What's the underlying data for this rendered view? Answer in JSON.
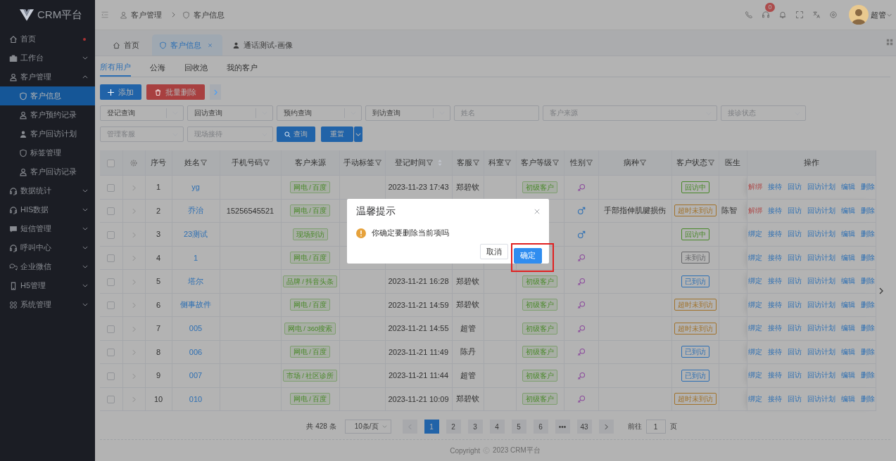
{
  "logo": {
    "text": "CRM平台"
  },
  "sidebar": {
    "items": [
      {
        "label": "首页",
        "selected": false,
        "dot": true
      },
      {
        "label": "工作台",
        "selected": false,
        "expanded": false
      },
      {
        "label": "客户管理",
        "selected": false,
        "expanded": true,
        "children": [
          {
            "label": "客户信息",
            "selected": true
          },
          {
            "label": "客户预约记录",
            "selected": false
          },
          {
            "label": "客户回访计划",
            "selected": false
          },
          {
            "label": "标签管理",
            "selected": false
          },
          {
            "label": "客户回访记录",
            "selected": false
          }
        ]
      },
      {
        "label": "数据统计",
        "selected": false,
        "expanded": false
      },
      {
        "label": "HIS数据",
        "selected": false,
        "expanded": false
      },
      {
        "label": "短信管理",
        "selected": false,
        "expanded": false
      },
      {
        "label": "呼叫中心",
        "selected": false,
        "expanded": false
      },
      {
        "label": "企业微信",
        "selected": false,
        "expanded": false
      },
      {
        "label": "H5管理",
        "selected": false,
        "expanded": false
      },
      {
        "label": "系统管理",
        "selected": false,
        "expanded": false
      }
    ]
  },
  "header": {
    "breadcrumb": [
      "客户管理",
      "客户信息"
    ],
    "notification_count": "0",
    "user": "超管"
  },
  "tabs": [
    {
      "label": "首页",
      "selected": false,
      "closable": false
    },
    {
      "label": "客户信息",
      "selected": true,
      "closable": true
    },
    {
      "label": "通话测试-画像",
      "selected": false,
      "closable": false
    }
  ],
  "subtabs": [
    {
      "label": "所有用户",
      "selected": true
    },
    {
      "label": "公海",
      "selected": false
    },
    {
      "label": "回收池",
      "selected": false
    },
    {
      "label": "我的客户",
      "selected": false
    }
  ],
  "toolbar": [
    {
      "label": "添加",
      "kind": "primary"
    },
    {
      "label": "批量删除",
      "kind": "danger"
    }
  ],
  "filters": [
    [
      {
        "kind": "select",
        "value": "登记查询"
      },
      {
        "kind": "select",
        "value": "回访查询"
      },
      {
        "kind": "select",
        "value": "预约查询"
      },
      {
        "kind": "select",
        "value": "到访查询"
      },
      {
        "kind": "input",
        "placeholder": "姓名"
      },
      {
        "kind": "select",
        "placeholder": "客户来源"
      },
      {
        "kind": "select",
        "placeholder": "接诊状态"
      }
    ],
    [
      {
        "kind": "select",
        "placeholder": "管理客服"
      },
      {
        "kind": "select",
        "placeholder": "现场接待"
      },
      {
        "kind": "primary",
        "label": "查询"
      },
      {
        "kind": "primary",
        "label": "重置"
      }
    ]
  ],
  "table": {
    "select_all": {
      "checked": false
    },
    "columns": [
      {
        "label": "序号",
        "filter": false
      },
      {
        "label": "姓名",
        "filter": true
      },
      {
        "label": "手机号码",
        "filter": true
      },
      {
        "label": "客户来源",
        "filter": false
      },
      {
        "label": "手动标签",
        "filter": true
      },
      {
        "label": "登记时间",
        "filter": true,
        "sortable": true
      },
      {
        "label": "客服",
        "filter": true
      },
      {
        "label": "科室",
        "filter": true
      },
      {
        "label": "客户等级",
        "filter": true
      },
      {
        "label": "性别",
        "filter": true
      },
      {
        "label": "病种",
        "filter": true
      },
      {
        "label": "客户状态",
        "filter": true
      },
      {
        "label": "医生",
        "filter": false
      },
      {
        "label": "操作",
        "filter": false
      }
    ],
    "rows": [
      {
        "checked": false,
        "expanded": false,
        "no": "1",
        "name": "yg",
        "source": "网电 / 百度",
        "time": "2023-11-23 17:43",
        "agent": "郑碧钦",
        "level": "初级客户",
        "male": false,
        "status": {
          "text": "回访中",
          "color": "#488828"
        },
        "actions": [
          {
            "label": "解绑",
            "danger": true
          },
          {
            "label": "接待",
            "danger": false
          },
          {
            "label": "回访",
            "danger": false
          },
          {
            "label": "回访计划",
            "danger": false
          },
          {
            "label": "编辑",
            "danger": false
          },
          {
            "label": "删除",
            "danger": false
          }
        ]
      },
      {
        "checked": false,
        "expanded": false,
        "no": "2",
        "name": "乔治",
        "phone": "15256545521",
        "source": "网电 / 百度",
        "male": true,
        "disease": "手部指伸肌腱损伤",
        "status": {
          "text": "超时未到访",
          "color": "#a1722a"
        },
        "doctor": "陈智",
        "actions": [
          {
            "label": "解绑",
            "danger": true
          },
          {
            "label": "接待",
            "danger": false
          },
          {
            "label": "回访",
            "danger": false
          },
          {
            "label": "回访计划",
            "danger": false
          },
          {
            "label": "编辑",
            "danger": false
          },
          {
            "label": "删除",
            "danger": false
          }
        ]
      },
      {
        "checked": false,
        "expanded": false,
        "no": "3",
        "name": "23测试",
        "source": "现场到访",
        "male": true,
        "status": {
          "text": "回访中",
          "color": "#488828"
        },
        "actions": [
          {
            "label": "绑定",
            "danger": false
          },
          {
            "label": "接待",
            "danger": false
          },
          {
            "label": "回访",
            "danger": false
          },
          {
            "label": "回访计划",
            "danger": false
          },
          {
            "label": "编辑",
            "danger": false
          },
          {
            "label": "删除",
            "danger": false
          }
        ]
      },
      {
        "checked": false,
        "expanded": false,
        "no": "4",
        "name": "1",
        "source": "网电 / 百度",
        "male": false,
        "status": {
          "text": "未到访",
          "color": "#656669"
        },
        "actions": [
          {
            "label": "绑定",
            "danger": false
          },
          {
            "label": "接待",
            "danger": false
          },
          {
            "label": "回访",
            "danger": false
          },
          {
            "label": "回访计划",
            "danger": false
          },
          {
            "label": "编辑",
            "danger": false
          },
          {
            "label": "删除",
            "danger": false
          }
        ]
      },
      {
        "checked": false,
        "expanded": false,
        "no": "5",
        "name": "塔尔",
        "source": "品牌 / 抖音头条",
        "time": "2023-11-21 16:28",
        "agent": "郑碧钦",
        "level": "初级客户",
        "male": false,
        "status": {
          "text": "已到访",
          "color": "#2d6fb3"
        },
        "actions": [
          {
            "label": "绑定",
            "danger": false
          },
          {
            "label": "接待",
            "danger": false
          },
          {
            "label": "回访",
            "danger": false
          },
          {
            "label": "回访计划",
            "danger": false
          },
          {
            "label": "编辑",
            "danger": false
          },
          {
            "label": "删除",
            "danger": false
          }
        ]
      },
      {
        "checked": false,
        "expanded": false,
        "no": "6",
        "name": "侧事故件",
        "source": "网电 / 百度",
        "time": "2023-11-21 14:59",
        "agent": "郑碧钦",
        "level": "初级客户",
        "male": false,
        "status": {
          "text": "超时未到访",
          "color": "#a1722a"
        },
        "actions": [
          {
            "label": "绑定",
            "danger": false
          },
          {
            "label": "接待",
            "danger": false
          },
          {
            "label": "回访",
            "danger": false
          },
          {
            "label": "回访计划",
            "danger": false
          },
          {
            "label": "编辑",
            "danger": false
          },
          {
            "label": "删除",
            "danger": false
          }
        ]
      },
      {
        "checked": false,
        "expanded": false,
        "no": "7",
        "name": "005",
        "source": "网电 / 360搜索",
        "time": "2023-11-21 14:55",
        "agent": "超管",
        "level": "初级客户",
        "male": false,
        "status": {
          "text": "超时未到访",
          "color": "#a1722a"
        },
        "actions": [
          {
            "label": "绑定",
            "danger": false
          },
          {
            "label": "接待",
            "danger": false
          },
          {
            "label": "回访",
            "danger": false
          },
          {
            "label": "回访计划",
            "danger": false
          },
          {
            "label": "编辑",
            "danger": false
          },
          {
            "label": "删除",
            "danger": false
          }
        ]
      },
      {
        "checked": false,
        "expanded": false,
        "no": "8",
        "name": "006",
        "source": "网电 / 百度",
        "time": "2023-11-21 11:49",
        "agent": "陈丹",
        "level": "初级客户",
        "male": false,
        "status": {
          "text": "已到访",
          "color": "#2d6fb3"
        },
        "actions": [
          {
            "label": "绑定",
            "danger": false
          },
          {
            "label": "接待",
            "danger": false
          },
          {
            "label": "回访",
            "danger": false
          },
          {
            "label": "回访计划",
            "danger": false
          },
          {
            "label": "编辑",
            "danger": false
          },
          {
            "label": "删除",
            "danger": false
          }
        ]
      },
      {
        "checked": false,
        "expanded": false,
        "no": "9",
        "name": "007",
        "source": "市场 / 社区诊所",
        "time": "2023-11-21 11:44",
        "agent": "超管",
        "level": "初级客户",
        "male": false,
        "status": {
          "text": "已到访",
          "color": "#2d6fb3"
        },
        "actions": [
          {
            "label": "绑定",
            "danger": false
          },
          {
            "label": "接待",
            "danger": false
          },
          {
            "label": "回访",
            "danger": false
          },
          {
            "label": "回访计划",
            "danger": false
          },
          {
            "label": "编辑",
            "danger": false
          },
          {
            "label": "删除",
            "danger": false
          }
        ]
      },
      {
        "checked": false,
        "expanded": false,
        "no": "10",
        "name": "010",
        "source": "网电 / 百度",
        "time": "2023-11-21 10:09",
        "agent": "郑碧钦",
        "level": "初级客户",
        "male": false,
        "status": {
          "text": "超时未到访",
          "color": "#a1722a"
        },
        "actions": [
          {
            "label": "绑定",
            "danger": false
          },
          {
            "label": "接待",
            "danger": false
          },
          {
            "label": "回访",
            "danger": false
          },
          {
            "label": "回访计划",
            "danger": false
          },
          {
            "label": "编辑",
            "danger": false
          },
          {
            "label": "删除",
            "danger": false
          }
        ]
      }
    ]
  },
  "pagination": {
    "total": "共 428 条",
    "page_size": "10条/页",
    "prev_disabled": true,
    "pages": [
      {
        "label": "1",
        "selected": true
      },
      {
        "label": "2",
        "selected": false
      },
      {
        "label": "3",
        "selected": false
      },
      {
        "label": "4",
        "selected": false
      },
      {
        "label": "5",
        "selected": false
      },
      {
        "label": "6",
        "selected": false
      },
      {
        "label": "•••",
        "selected": false
      },
      {
        "label": "43",
        "selected": false
      }
    ],
    "goto_label": "前往",
    "goto_value": "1",
    "goto_unit": "页"
  },
  "footer": {
    "prefix": "Copyright",
    "text": "2023 CRM平台"
  },
  "dialog": {
    "title": "温馨提示",
    "message": "你确定要删除当前项吗",
    "buttons": [
      {
        "label": "取消",
        "kind": "default"
      },
      {
        "label": "确定",
        "kind": "primary",
        "highlighted": true
      }
    ]
  }
}
